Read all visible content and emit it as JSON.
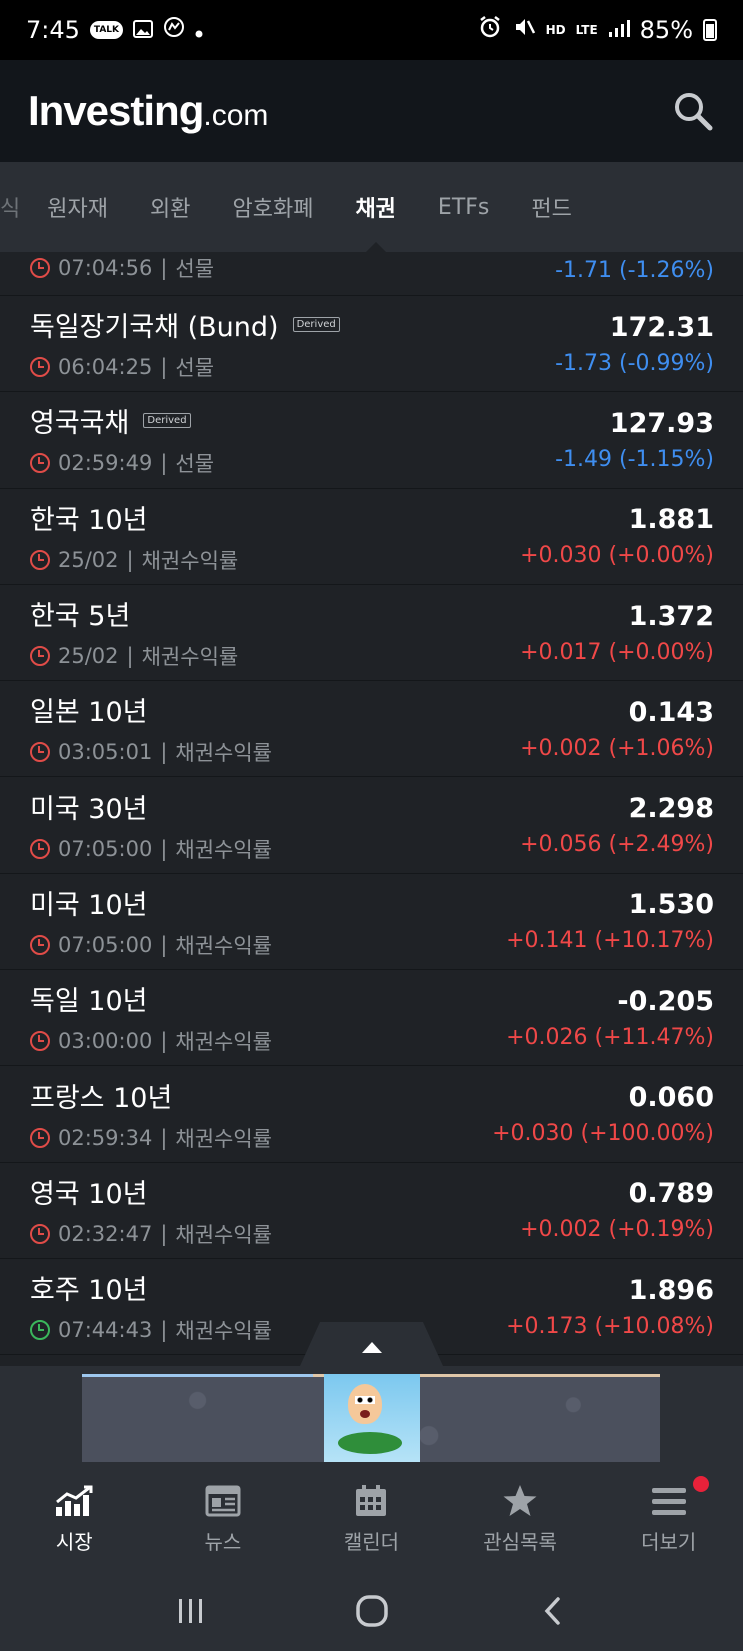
{
  "status_bar": {
    "time": "7:45",
    "talk_badge": "TALK",
    "battery": "85%",
    "network": "LTE",
    "hd_voice": "HD"
  },
  "header": {
    "logo_main": "Investing",
    "logo_suffix": ".com"
  },
  "tabs": [
    {
      "label": "식",
      "partial": true
    },
    {
      "label": "원자재"
    },
    {
      "label": "외환"
    },
    {
      "label": "암호화폐"
    },
    {
      "label": "채권",
      "active": true
    },
    {
      "label": "ETFs"
    },
    {
      "label": "펀드"
    }
  ],
  "first_row": {
    "time": "07:04:56",
    "type": "선물",
    "change": "-1.71 (-1.26%)"
  },
  "rows": [
    {
      "name": "독일장기국채 (Bund)",
      "derived": "Derived",
      "time": "06:04:25",
      "type": "선물",
      "price": "172.31",
      "change": "-1.73 (-0.99%)",
      "direction": "down",
      "clock": "red"
    },
    {
      "name": "영국국채",
      "derived": "Derived",
      "time": "02:59:49",
      "type": "선물",
      "price": "127.93",
      "change": "-1.49 (-1.15%)",
      "direction": "down",
      "clock": "red"
    },
    {
      "name": "한국 10년",
      "time": "25/02",
      "type": "채권수익률",
      "price": "1.881",
      "change": "+0.030 (+0.00%)",
      "direction": "up",
      "clock": "red"
    },
    {
      "name": "한국 5년",
      "time": "25/02",
      "type": "채권수익률",
      "price": "1.372",
      "change": "+0.017 (+0.00%)",
      "direction": "up",
      "clock": "red"
    },
    {
      "name": "일본 10년",
      "time": "03:05:01",
      "type": "채권수익률",
      "price": "0.143",
      "change": "+0.002 (+1.06%)",
      "direction": "up",
      "clock": "red"
    },
    {
      "name": "미국 30년",
      "time": "07:05:00",
      "type": "채권수익률",
      "price": "2.298",
      "change": "+0.056 (+2.49%)",
      "direction": "up",
      "clock": "red"
    },
    {
      "name": "미국 10년",
      "time": "07:05:00",
      "type": "채권수익률",
      "price": "1.530",
      "change": "+0.141 (+10.17%)",
      "direction": "up",
      "clock": "red"
    },
    {
      "name": "독일 10년",
      "time": "03:00:00",
      "type": "채권수익률",
      "price": "-0.205",
      "change": "+0.026 (+11.47%)",
      "direction": "up",
      "clock": "red"
    },
    {
      "name": "프랑스 10년",
      "time": "02:59:34",
      "type": "채권수익률",
      "price": "0.060",
      "change": "+0.030 (+100.00%)",
      "direction": "up",
      "clock": "red"
    },
    {
      "name": "영국 10년",
      "time": "02:32:47",
      "type": "채권수익률",
      "price": "0.789",
      "change": "+0.002 (+0.19%)",
      "direction": "up",
      "clock": "red"
    },
    {
      "name": "호주 10년",
      "time": "07:44:43",
      "type": "채권수익률",
      "price": "1.896",
      "change": "+0.173 (+10.08%)",
      "direction": "up",
      "clock": "green"
    }
  ],
  "bottom_nav": [
    {
      "label": "시장",
      "icon": "chart-icon",
      "active": true
    },
    {
      "label": "뉴스",
      "icon": "news-icon"
    },
    {
      "label": "캘린더",
      "icon": "calendar-icon"
    },
    {
      "label": "관심목록",
      "icon": "star-icon"
    },
    {
      "label": "더보기",
      "icon": "menu-icon",
      "badge": true
    }
  ],
  "colors": {
    "up": "#f04848",
    "down": "#3f8ef0",
    "accent_green": "#3bb75c",
    "badge": "#e8223a"
  }
}
